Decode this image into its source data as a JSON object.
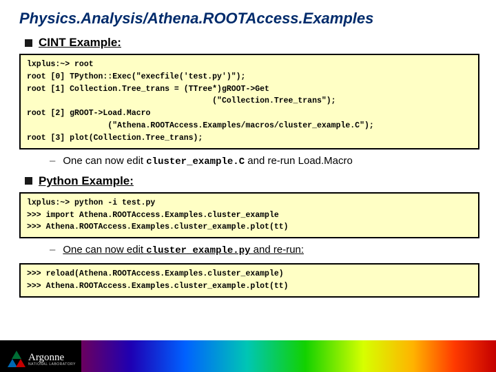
{
  "title": "Physics.Analysis/Athena.ROOTAccess.Examples",
  "section1": {
    "label": "CINT Example:"
  },
  "code1": "lxplus:~> root\nroot [0] TPython::Exec(\"execfile('test.py')\");\nroot [1] Collection.Tree_trans = (TTree*)gROOT->Get\n                                       (\"Collection.Tree_trans\");\nroot [2] gROOT->Load.Macro\n                 (\"Athena.ROOTAccess.Examples/macros/cluster_example.C\");\nroot [3] plot(Collection.Tree_trans);",
  "note1": {
    "pre": "One can now edit ",
    "mono": "cluster_example.C",
    "post": " and re-run Load.Macro"
  },
  "section2": {
    "label": "Python Example:"
  },
  "code2": "lxplus:~> python -i test.py\n>>> import Athena.ROOTAccess.Examples.cluster_example\n>>> Athena.ROOTAccess.Examples.cluster_example.plot(tt)",
  "note2": {
    "pre": "One can now edit ",
    "mono": "cluster_example.py",
    "post": " and re-run:"
  },
  "code3": ">>> reload(Athena.ROOTAccess.Examples.cluster_example)\n>>> Athena.ROOTAccess.Examples.cluster_example.plot(tt)",
  "footer": {
    "brand": "Argonne",
    "sub": "NATIONAL LABORATORY"
  }
}
